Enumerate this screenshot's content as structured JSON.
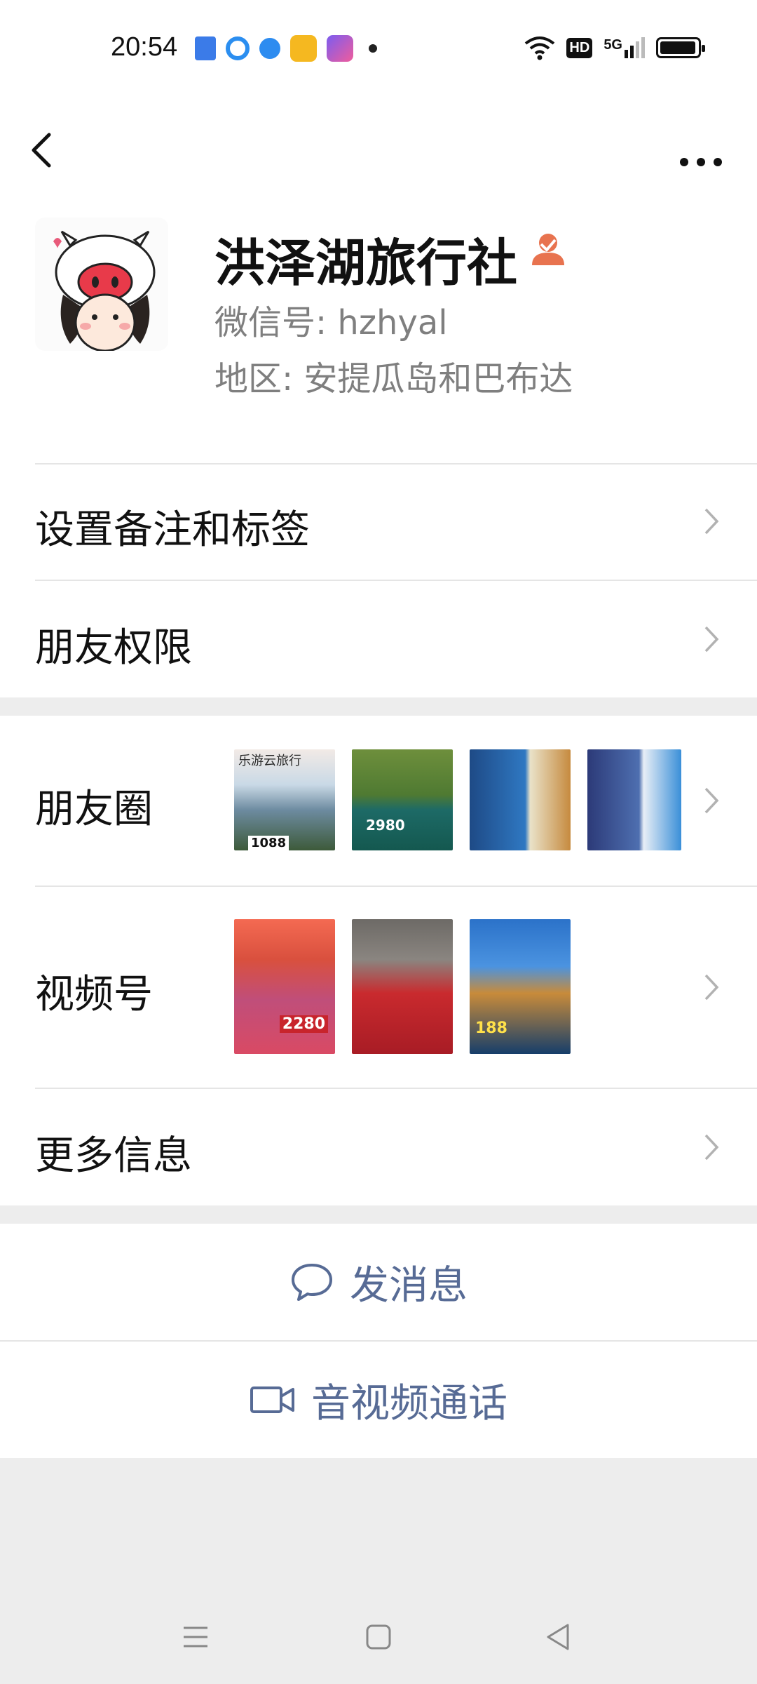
{
  "status": {
    "time": "20:54",
    "hd_badge": "HD",
    "network": "5G"
  },
  "profile": {
    "name": "洪泽湖旅行社",
    "wechat_id": "微信号: hzhyal",
    "region": "地区: 安提瓜岛和巴布达"
  },
  "rows": {
    "remark": "设置备注和标签",
    "permissions": "朋友权限",
    "moments": "朋友圈",
    "channels": "视频号",
    "more_info": "更多信息"
  },
  "moments_thumbs": [
    {
      "caption": "乐游云旅行",
      "price": "1088"
    },
    {
      "caption": "",
      "price": "2980"
    },
    {
      "caption": "",
      "price": ""
    },
    {
      "caption": "",
      "price": ""
    }
  ],
  "channels_thumbs": [
    {
      "caption": "2280"
    },
    {
      "caption": ""
    },
    {
      "caption": "188"
    }
  ],
  "actions": {
    "message": "发消息",
    "call": "音视频通话"
  },
  "colors": {
    "link": "#576b95",
    "verified": "#e8734f",
    "divider_gap": "#ededed"
  }
}
